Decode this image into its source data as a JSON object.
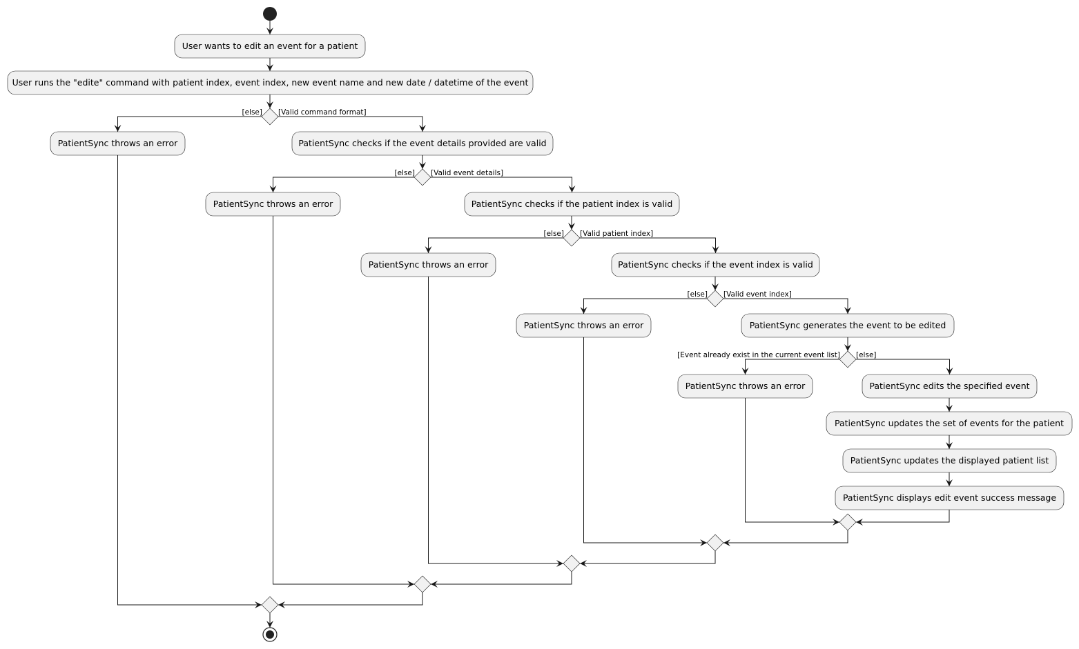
{
  "diagram": {
    "type": "activity",
    "colors": {
      "node_fill": "#f1f1f1",
      "line": "#181818",
      "start_end": "#222222"
    },
    "activities": [
      "User wants to edit an event for a patient",
      "User runs the \"edite\" command with patient index, event index, new event name and new date / datetime of the event",
      "PatientSync throws an error",
      "PatientSync checks if the event details provided are valid",
      "PatientSync throws an error",
      "PatientSync checks if the patient index is valid",
      "PatientSync throws an error",
      "PatientSync checks if the event index is valid",
      "PatientSync throws an error",
      "PatientSync generates the event to be edited",
      "PatientSync throws an error",
      "PatientSync edits the specified event",
      "PatientSync updates the set of events for the patient",
      "PatientSync updates the displayed patient list",
      "PatientSync displays edit event success message"
    ],
    "decisions": [
      {
        "left": "[else]",
        "right": "[Valid command format]"
      },
      {
        "left": "[else]",
        "right": "[Valid event details]"
      },
      {
        "left": "[else]",
        "right": "[Valid patient index]"
      },
      {
        "left": "[else]",
        "right": "[Valid event index]"
      },
      {
        "left": "[Event already exist in the current event list]",
        "right": "[else]"
      }
    ]
  }
}
